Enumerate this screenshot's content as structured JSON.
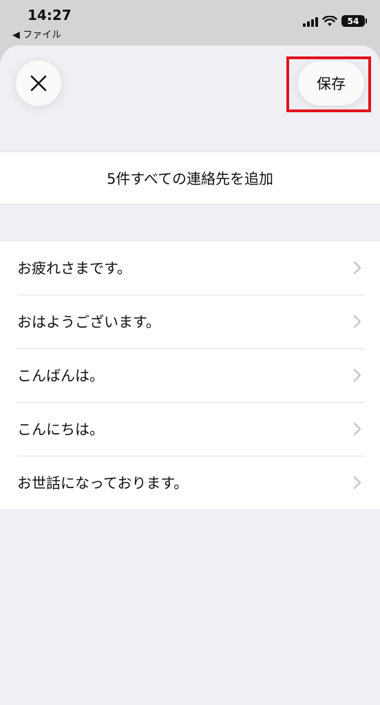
{
  "status_bar": {
    "time": "14:27",
    "back_app": "◀ ファイル",
    "battery": "54"
  },
  "toolbar": {
    "save_label": "保存"
  },
  "add_all": {
    "label": "5件すべての連絡先を追加"
  },
  "contacts": [
    {
      "label": "お疲れさまです。"
    },
    {
      "label": "おはようございます。"
    },
    {
      "label": "こんばんは。"
    },
    {
      "label": "こんにちは。"
    },
    {
      "label": "お世話になっております。"
    }
  ],
  "colors": {
    "highlight": "#e3101c",
    "sheet_background": "#f0f0f4"
  }
}
